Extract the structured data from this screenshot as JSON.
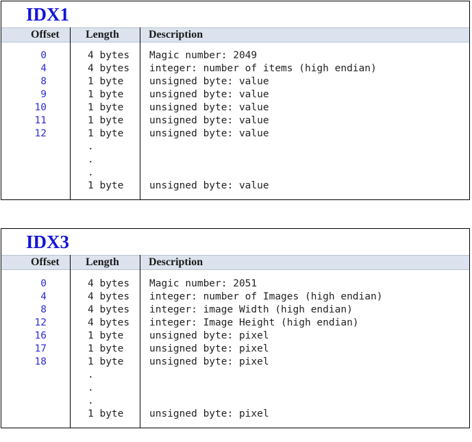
{
  "idx1": {
    "title": "IDX1",
    "headers": {
      "offset": "Offset",
      "length": "Length",
      "description": "Description"
    },
    "rows": [
      {
        "offset": "0",
        "length": "4 bytes",
        "description": "Magic number: 2049"
      },
      {
        "offset": "4",
        "length": "4 bytes",
        "description": "integer: number of items (high endian)"
      },
      {
        "offset": "8",
        "length": "1 byte",
        "description": "unsigned byte: value"
      },
      {
        "offset": "9",
        "length": "1 byte",
        "description": "unsigned byte: value"
      },
      {
        "offset": "10",
        "length": "1 byte",
        "description": "unsigned byte: value"
      },
      {
        "offset": "11",
        "length": "1 byte",
        "description": "unsigned byte: value"
      },
      {
        "offset": "12",
        "length": "1 byte",
        "description": "unsigned byte: value"
      },
      {
        "offset": "",
        "length": ".",
        "description": ""
      },
      {
        "offset": "",
        "length": ".",
        "description": ""
      },
      {
        "offset": "",
        "length": ".",
        "description": ""
      },
      {
        "offset": "",
        "length": "1 byte",
        "description": "unsigned byte: value"
      }
    ]
  },
  "idx3": {
    "title": "IDX3",
    "headers": {
      "offset": "Offset",
      "length": "Length",
      "description": "Description"
    },
    "rows": [
      {
        "offset": "0",
        "length": "4 bytes",
        "description": "Magic number: 2051"
      },
      {
        "offset": "4",
        "length": "4 bytes",
        "description": "integer: number of Images (high endian)"
      },
      {
        "offset": "8",
        "length": "4 bytes",
        "description": "integer: image Width (high endian)"
      },
      {
        "offset": "12",
        "length": "4 bytes",
        "description": "integer: Image Height (high endian)"
      },
      {
        "offset": "16",
        "length": "1 byte",
        "description": "unsigned byte: pixel"
      },
      {
        "offset": "17",
        "length": "1 byte",
        "description": "unsigned byte: pixel"
      },
      {
        "offset": "18",
        "length": "1 byte",
        "description": "unsigned byte: pixel"
      },
      {
        "offset": "",
        "length": ".",
        "description": ""
      },
      {
        "offset": "",
        "length": ".",
        "description": ""
      },
      {
        "offset": "",
        "length": ".",
        "description": ""
      },
      {
        "offset": "",
        "length": "1 byte",
        "description": "unsigned byte: pixel"
      }
    ]
  }
}
